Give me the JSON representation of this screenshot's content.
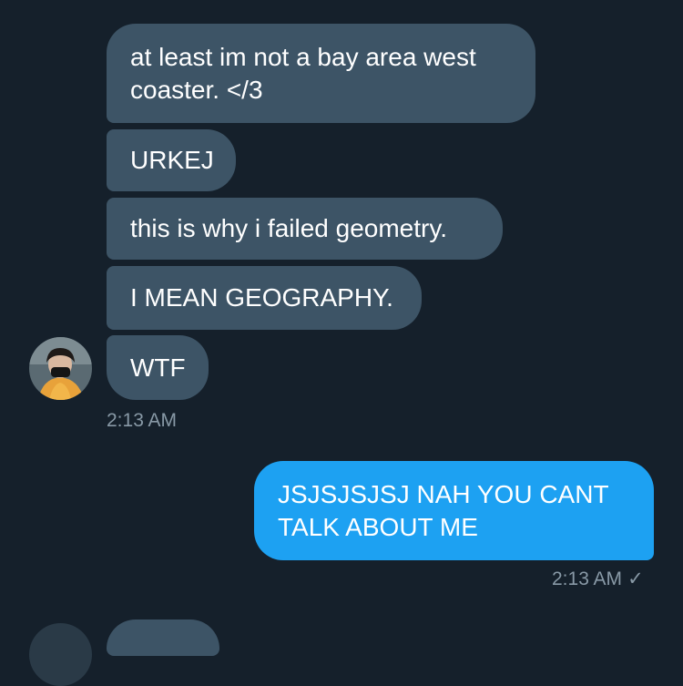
{
  "conversation": {
    "received": [
      {
        "text": "at least im not a bay area west\ncoaster. </3"
      },
      {
        "text": "URKEJ"
      },
      {
        "text": "this is why i failed geometry."
      },
      {
        "text": "I MEAN GEOGRAPHY."
      },
      {
        "text": "WTF"
      }
    ],
    "received_time": "2:13 AM",
    "sent": [
      {
        "text": "JSJSJSJSJ NAH YOU CANT\nTALK ABOUT ME"
      }
    ],
    "sent_time": "2:13 AM",
    "sent_status_icon": "checkmark-icon",
    "sent_status_glyph": "✓"
  },
  "colors": {
    "background": "#15202b",
    "received_bubble": "#3d5466",
    "sent_bubble": "#1da1f2",
    "timestamp": "#8899a6"
  }
}
